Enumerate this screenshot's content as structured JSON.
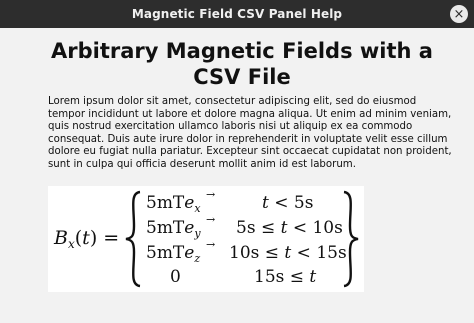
{
  "window": {
    "title": "Magnetic Field CSV Panel Help"
  },
  "icons": {
    "close": "close-icon"
  },
  "main": {
    "heading_line1": "Arbitrary Magnetic Fields with a",
    "heading_line2": "CSV File",
    "paragraph": "Lorem ipsum dolor sit amet, consectetur adipiscing elit, sed do eiusmod tempor incididunt ut labore et dolore magna aliqua. Ut enim ad minim veniam, quis nostrud exercitation ullamco laboris nisi ut aliquip ex ea commodo consequat. Duis aute irure dolor in reprehenderit in voluptate velit esse cillum dolore eu fugiat nulla pariatur. Excepteur sint occaecat cupidatat non proident, sunt in culpa qui officia deserunt mollit anim id est laborum."
  },
  "formula": {
    "lhs": "B_x(t) =",
    "rows": [
      {
        "value": "5mT e_x",
        "condition": "t < 5s"
      },
      {
        "value": "5mT e_y",
        "condition": "5s ≤ t < 10s"
      },
      {
        "value": "5mT e_z",
        "condition": "10s ≤ t < 15s"
      },
      {
        "value": "0",
        "condition": "15s ≤ t"
      }
    ]
  }
}
